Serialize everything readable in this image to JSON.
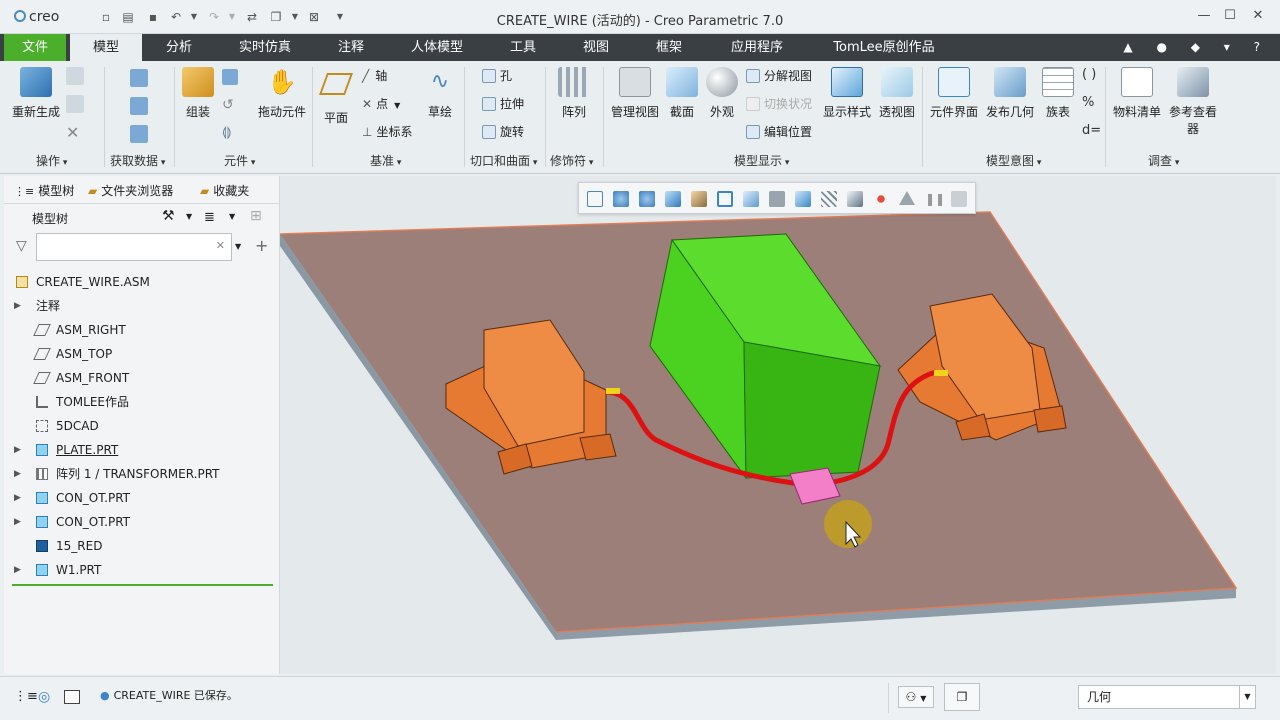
{
  "app": {
    "logo": "creo",
    "title": "CREATE_WIRE (活动的) - Creo Parametric 7.0"
  },
  "tabs": [
    "文件",
    "模型",
    "分析",
    "实时仿真",
    "注释",
    "人体模型",
    "工具",
    "视图",
    "框架",
    "应用程序",
    "TomLee原创作品"
  ],
  "ribbon": {
    "regen": "重新生成",
    "assemble": "组装",
    "drag": "拖动元件",
    "plane": "平面",
    "axis": "轴",
    "point": "点",
    "csys": "坐标系",
    "sketch": "草绘",
    "hole": "孔",
    "extrude": "拉伸",
    "revolve": "旋转",
    "pattern": "阵列",
    "manage_views": "管理视图",
    "section": "截面",
    "appearance": "外观",
    "explode": "分解视图",
    "toggle_status": "切换状况",
    "edit_position": "编辑位置",
    "display_style": "显示样式",
    "perspective": "透视图",
    "component_interface": "元件界面",
    "publish_geom": "发布几何",
    "family_table": "族表",
    "bom": "物料清单",
    "ref_viewer": "参考查看器"
  },
  "groups": {
    "operations": "操作",
    "get_data": "获取数据",
    "component": "元件",
    "datum": "基准",
    "cut_surface": "切口和曲面",
    "modifier": "修饰符",
    "model_display": "模型显示",
    "model_intent": "模型意图",
    "investigate": "调查"
  },
  "panel": {
    "tabs": [
      "模型树",
      "文件夹浏览器",
      "收藏夹"
    ],
    "title": "模型树",
    "search_placeholder": ""
  },
  "tree": [
    {
      "label": "CREATE_WIRE.ASM",
      "icon": "assembly-icon",
      "expander": false,
      "indent": 0
    },
    {
      "label": "注释",
      "icon": "none",
      "expander": true,
      "indent": 1
    },
    {
      "label": "ASM_RIGHT",
      "icon": "datum-plane-icon",
      "expander": false,
      "indent": 1
    },
    {
      "label": "ASM_TOP",
      "icon": "datum-plane-icon",
      "expander": false,
      "indent": 1
    },
    {
      "label": "ASM_FRONT",
      "icon": "datum-plane-icon",
      "expander": false,
      "indent": 1
    },
    {
      "label": "TOMLEE作品",
      "icon": "csys-icon",
      "expander": false,
      "indent": 1
    },
    {
      "label": "5DCAD",
      "icon": "sketch-icon",
      "expander": false,
      "indent": 1
    },
    {
      "label": "PLATE.PRT",
      "icon": "part-icon",
      "expander": true,
      "indent": 1
    },
    {
      "label": "阵列 1 / TRANSFORMER.PRT",
      "icon": "pattern-icon",
      "expander": true,
      "indent": 1
    },
    {
      "label": "CON_OT.PRT",
      "icon": "part-icon",
      "expander": true,
      "indent": 1
    },
    {
      "label": "CON_OT.PRT",
      "icon": "part-icon",
      "expander": true,
      "indent": 1
    },
    {
      "label": "15_RED",
      "icon": "spool-icon",
      "expander": false,
      "indent": 1
    },
    {
      "label": "W1.PRT",
      "icon": "part-icon",
      "expander": true,
      "indent": 1
    }
  ],
  "status": {
    "message": "CREATE_WIRE 已保存。",
    "filter": "几何"
  }
}
